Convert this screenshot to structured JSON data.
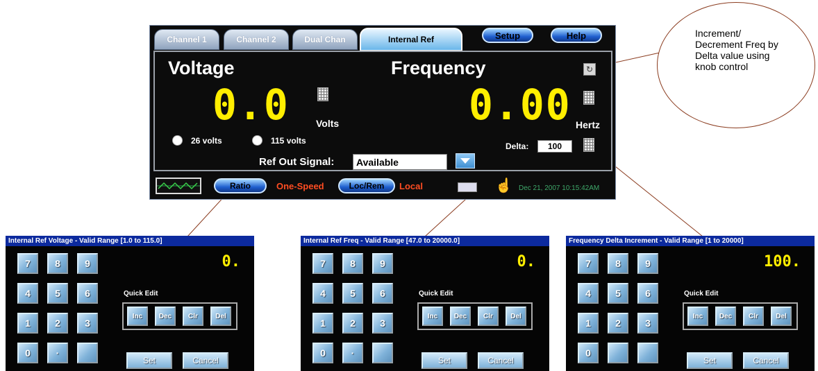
{
  "tabs": [
    "Channel 1",
    "Channel 2",
    "Dual Chan",
    "Internal Ref"
  ],
  "top_buttons": {
    "setup": "Setup",
    "help": "Help"
  },
  "voltage": {
    "label": "Voltage",
    "value": "0.0",
    "unit": "Volts"
  },
  "frequency": {
    "label": "Frequency",
    "value": "0.00",
    "unit": "Hertz"
  },
  "radios": {
    "opt1": "26 volts",
    "opt2": "115 volts"
  },
  "delta": {
    "label": "Delta:",
    "value": "100"
  },
  "ref_out": {
    "label": "Ref Out Signal:",
    "value": "Available"
  },
  "status": {
    "ratio": "Ratio",
    "speed": "One-Speed",
    "locrem": "Loc/Rem",
    "mode": "Local",
    "datetime": "Dec 21, 2007  10:15:42AM"
  },
  "callout": "Increment/ Decrement Freq by Delta value using knob control",
  "dialogs": [
    {
      "title": "Internal Ref Voltage - Valid Range [1.0 to 115.0]",
      "display": "0.",
      "keys": [
        "7",
        "8",
        "9",
        "4",
        "5",
        "6",
        "1",
        "2",
        "3",
        "0",
        "·",
        ""
      ]
    },
    {
      "title": "Internal Ref Freq - Valid Range [47.0 to 20000.0]",
      "display": "0.",
      "keys": [
        "7",
        "8",
        "9",
        "4",
        "5",
        "6",
        "1",
        "2",
        "3",
        "0",
        "·",
        ""
      ]
    },
    {
      "title": "Frequency Delta Increment - Valid Range [1 to 20000]",
      "display": "100.",
      "keys": [
        "7",
        "8",
        "9",
        "4",
        "5",
        "6",
        "1",
        "2",
        "3",
        "0",
        "",
        ""
      ]
    }
  ],
  "quick_edit": {
    "label": "Quick Edit",
    "inc": "Inc",
    "dec": "Dec",
    "clr": "Clr",
    "del": "Del"
  },
  "dialog_buttons": {
    "set": "Set",
    "cancel": "Cancel"
  }
}
